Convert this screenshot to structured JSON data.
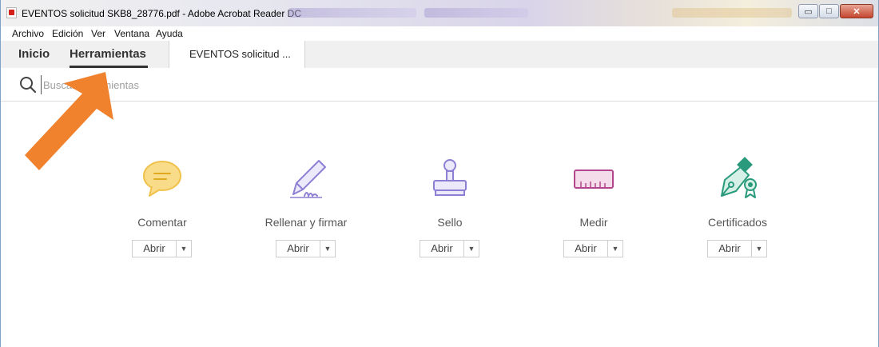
{
  "window": {
    "title": "EVENTOS solicitud SKB8_28776.pdf - Adobe Acrobat Reader DC",
    "controls": {
      "minimize": "▭",
      "maximize": "□",
      "close": "✕"
    }
  },
  "menu": {
    "items": [
      {
        "label": "Archivo"
      },
      {
        "label": "Edición"
      },
      {
        "label": "Ver"
      },
      {
        "label": "Ventana"
      },
      {
        "label": "Ayuda"
      }
    ]
  },
  "tabs": {
    "home": "Inicio",
    "tools": "Herramientas",
    "document": "EVENTOS solicitud ..."
  },
  "search": {
    "placeholder": "Buscar herramientas",
    "visible_text": "Busque",
    "visible_text_tail": "s herramientas"
  },
  "tools": [
    {
      "label": "Comentar",
      "icon": "comment-icon",
      "button": "Abrir",
      "color": "#f5c250"
    },
    {
      "label": "Rellenar y firmar",
      "icon": "fill-sign-icon",
      "button": "Abrir",
      "color": "#8c7fd4"
    },
    {
      "label": "Sello",
      "icon": "stamp-icon",
      "button": "Abrir",
      "color": "#8c7fd4"
    },
    {
      "label": "Medir",
      "icon": "measure-icon",
      "button": "Abrir",
      "color": "#b2478d"
    },
    {
      "label": "Certificados",
      "icon": "certificate-icon",
      "button": "Abrir",
      "color": "#2a9a7c"
    }
  ],
  "colors": {
    "arrow": "#f0822e",
    "tab_underline": "#333333"
  }
}
